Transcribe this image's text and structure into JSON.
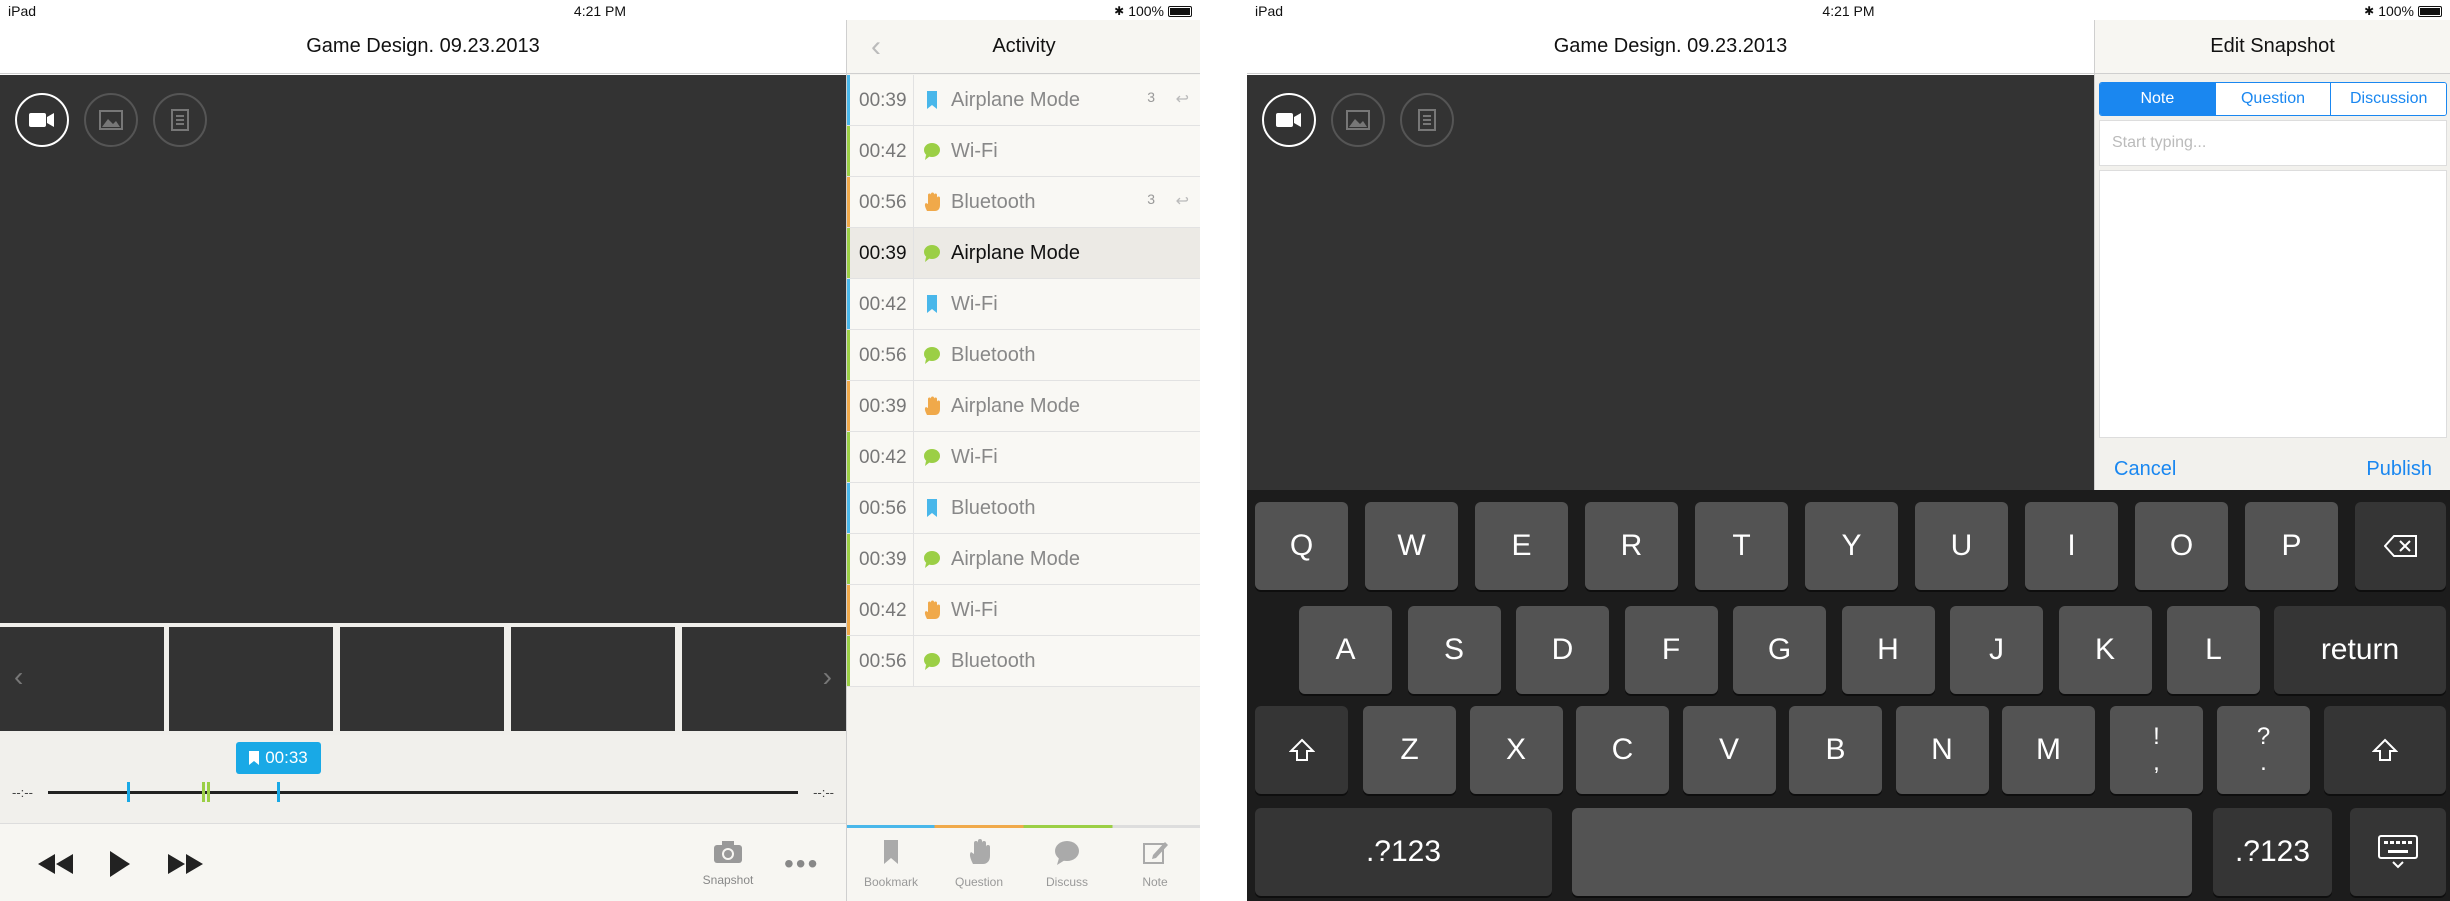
{
  "left": {
    "status": {
      "device": "iPad",
      "time": "4:21 PM"
    },
    "title": "Game Design. 09.23.2013",
    "media_modes": [
      {
        "icon": "video-camera-icon",
        "active": true
      },
      {
        "icon": "image-icon",
        "active": false
      },
      {
        "icon": "document-icon",
        "active": false
      }
    ],
    "timeline": {
      "start": "--:--",
      "end": "--:--",
      "marker_time": "00:33"
    },
    "controls": {
      "snapshot_label": "Snapshot"
    },
    "activity": {
      "title": "Activity",
      "rows": [
        {
          "time": "00:39",
          "type": "bookmark",
          "label": "Airplane Mode",
          "count": "3"
        },
        {
          "time": "00:42",
          "type": "discuss",
          "label": "Wi-Fi",
          "count": ""
        },
        {
          "time": "00:56",
          "type": "question",
          "label": "Bluetooth",
          "count": "3"
        },
        {
          "time": "00:39",
          "type": "discuss",
          "label": "Airplane Mode",
          "count": ""
        },
        {
          "time": "00:42",
          "type": "bookmark",
          "label": "Wi-Fi",
          "count": ""
        },
        {
          "time": "00:56",
          "type": "discuss",
          "label": "Bluetooth",
          "count": ""
        },
        {
          "time": "00:39",
          "type": "question",
          "label": "Airplane Mode",
          "count": ""
        },
        {
          "time": "00:42",
          "type": "discuss",
          "label": "Wi-Fi",
          "count": ""
        },
        {
          "time": "00:56",
          "type": "bookmark",
          "label": "Bluetooth",
          "count": ""
        },
        {
          "time": "00:39",
          "type": "discuss",
          "label": "Airplane Mode",
          "count": ""
        },
        {
          "time": "00:42",
          "type": "question",
          "label": "Wi-Fi",
          "count": ""
        },
        {
          "time": "00:56",
          "type": "discuss",
          "label": "Bluetooth",
          "count": ""
        }
      ],
      "tabs": [
        "Bookmark",
        "Question",
        "Discuss",
        "Note"
      ]
    },
    "battery": "100%"
  },
  "right": {
    "status": {
      "device": "iPad",
      "time": "4:21 PM"
    },
    "battery": "100%",
    "title": "Game Design. 09.23.2013",
    "snapshot": {
      "title": "Edit Snapshot",
      "segments": [
        "Note",
        "Question",
        "Discussion"
      ],
      "placeholder": "Start typing...",
      "cancel": "Cancel",
      "publish": "Publish"
    },
    "keyboard": {
      "row1": [
        "Q",
        "W",
        "E",
        "R",
        "T",
        "Y",
        "U",
        "I",
        "O",
        "P"
      ],
      "row2": [
        "A",
        "S",
        "D",
        "F",
        "G",
        "H",
        "J",
        "K",
        "L"
      ],
      "row3": [
        "Z",
        "X",
        "C",
        "V",
        "B",
        "N",
        "M"
      ],
      "return": "return",
      "numbers": ".?123",
      "punct1": [
        "!",
        ","
      ],
      "punct2": [
        "?",
        "."
      ]
    }
  },
  "colors": {
    "bookmark": "#49b7ea",
    "question": "#f0a94a",
    "discuss": "#9bcf45",
    "accent": "#1a87f0",
    "timeline_marker": "#19a9e6"
  }
}
